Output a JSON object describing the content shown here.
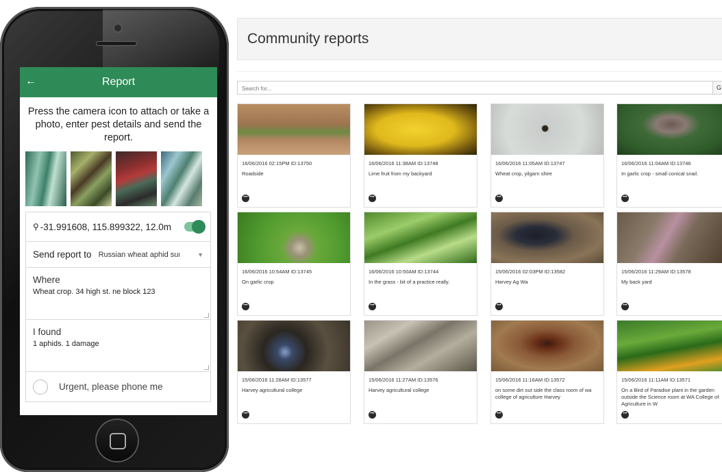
{
  "app": {
    "header": {
      "back_icon": "arrow-left-icon",
      "title": "Report"
    },
    "instructions": "Press the camera icon to attach or take a photo, enter pest details and send the report.",
    "photos": [
      "photo-1",
      "photo-2",
      "photo-3",
      "photo-4"
    ],
    "location": {
      "text": "-31.991608, 115.899322, 12.0m",
      "enabled": true
    },
    "send_to": {
      "label": "Send report to",
      "selected": "Russian wheat aphid surv"
    },
    "where": {
      "label": "Where",
      "value": "Wheat crop. 34 high st. ne block 123"
    },
    "found": {
      "label": "I found",
      "value": "1 aphids. 1 damage"
    },
    "urgent": {
      "label": "Urgent, please phone me",
      "checked": false
    },
    "accent_color": "#2e8b57"
  },
  "web": {
    "title": "Community reports",
    "search": {
      "placeholder": "Search for...",
      "button": "G"
    },
    "reports": [
      {
        "meta": "16/06/2016 02:15PM ID:13750",
        "desc": "Roadside"
      },
      {
        "meta": "16/06/2016 11:38AM ID:13748",
        "desc": "Lime fruit from my backyard"
      },
      {
        "meta": "16/06/2016 11:05AM ID:13747",
        "desc": "Wheat crop, yilgarn shire"
      },
      {
        "meta": "16/06/2016 11:04AM ID:13746",
        "desc": "In garlic crop - small conical snail."
      },
      {
        "meta": "16/06/2016 10:54AM ID:13745",
        "desc": "On garlic crop"
      },
      {
        "meta": "16/06/2016 10:50AM ID:13744",
        "desc": "In the grass - bit of a practice really."
      },
      {
        "meta": "15/06/2016 02:03PM ID:13582",
        "desc": "Harvey Ag Wa"
      },
      {
        "meta": "15/06/2016 11:29AM ID:13578",
        "desc": "My back yard"
      },
      {
        "meta": "15/06/2016 11:28AM ID:13577",
        "desc": "Harvey agricultural college"
      },
      {
        "meta": "15/06/2016 11:27AM ID:13576",
        "desc": "Harvey agricultural college"
      },
      {
        "meta": "15/06/2016 11:16AM ID:13572",
        "desc": "on some dirt out side the class room of wa college of agriculture Harvey"
      },
      {
        "meta": "15/06/2016 11:11AM ID:13571",
        "desc": "On a Bird of Paradise plant in the garden outside the Science room at WA College of Agriculture in W"
      }
    ]
  }
}
